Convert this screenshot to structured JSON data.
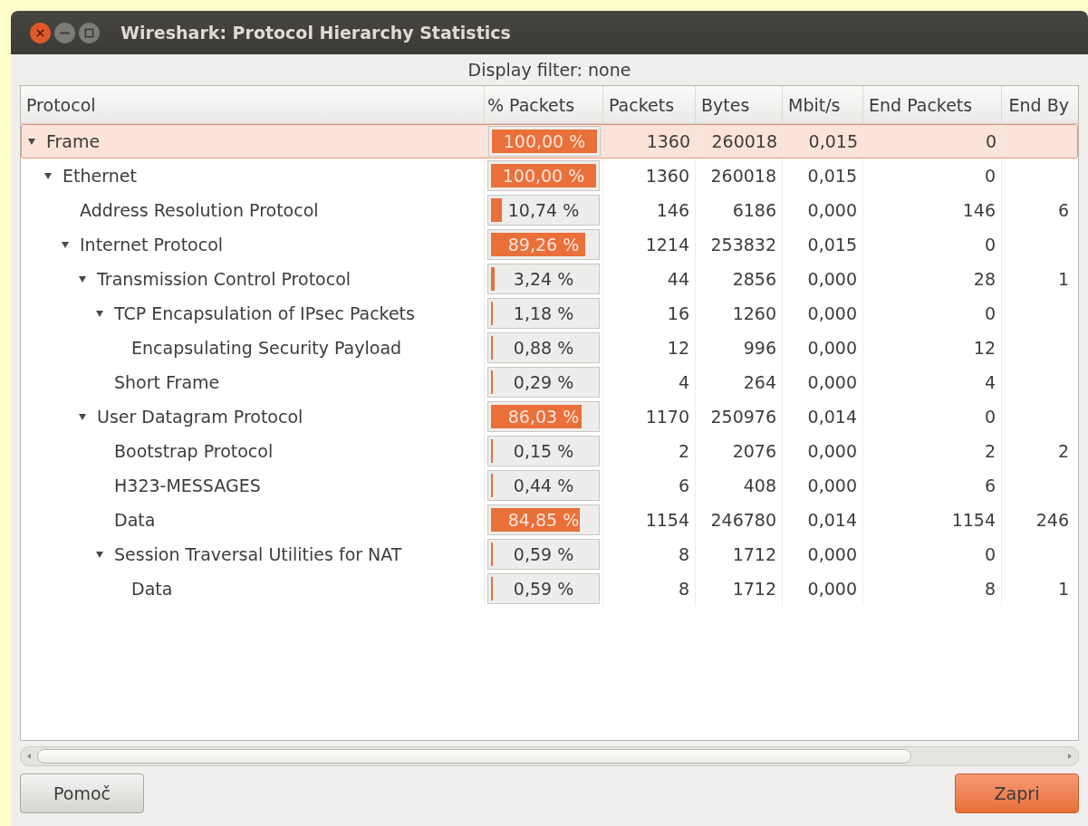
{
  "window": {
    "title": "Wireshark: Protocol Hierarchy Statistics"
  },
  "display_filter": "Display filter: none",
  "table": {
    "columns": [
      "Protocol",
      "% Packets",
      "Packets",
      "Bytes",
      "Mbit/s",
      "End Packets",
      "End By"
    ],
    "rows": [
      {
        "protocol": "Frame",
        "percent": "100,00 %",
        "level": 1.0,
        "packets": "1360",
        "bytes": "260018",
        "mbits": "0,015",
        "end_packets": "0",
        "selected": true,
        "expanded": true,
        "children": [
          {
            "protocol": "Ethernet",
            "percent": "100,00 %",
            "level": 1.0,
            "packets": "1360",
            "bytes": "260018",
            "mbits": "0,015",
            "end_packets": "0",
            "selected": false,
            "expanded": true,
            "children": [
              {
                "protocol": "Address Resolution Protocol",
                "percent": "10,74 %",
                "level": 0.1074,
                "packets": "146",
                "bytes": "6186",
                "mbits": "0,000",
                "end_packets": "146",
                "end_bytes": "6",
                "selected": false
              },
              {
                "protocol": "Internet Protocol",
                "percent": "89,26 %",
                "level": 0.8926,
                "packets": "1214",
                "bytes": "253832",
                "mbits": "0,015",
                "end_packets": "0",
                "selected": false,
                "expanded": true,
                "children": [
                  {
                    "protocol": "Transmission Control Protocol",
                    "percent": "3,24 %",
                    "level": 0.0324,
                    "packets": "44",
                    "bytes": "2856",
                    "mbits": "0,000",
                    "end_packets": "28",
                    "end_bytes": "1",
                    "selected": false,
                    "expanded": true,
                    "children": [
                      {
                        "protocol": "TCP Encapsulation of IPsec Packets",
                        "percent": "1,18 %",
                        "level": 0.0118,
                        "packets": "16",
                        "bytes": "1260",
                        "mbits": "0,000",
                        "end_packets": "0",
                        "selected": false,
                        "expanded": true,
                        "children": [
                          {
                            "protocol": "Encapsulating Security Payload",
                            "percent": "0,88 %",
                            "level": 0.0088,
                            "packets": "12",
                            "bytes": "996",
                            "mbits": "0,000",
                            "end_packets": "12",
                            "selected": false
                          }
                        ]
                      },
                      {
                        "protocol": "Short Frame",
                        "percent": "0,29 %",
                        "level": 0.0029,
                        "packets": "4",
                        "bytes": "264",
                        "mbits": "0,000",
                        "end_packets": "4",
                        "selected": false
                      }
                    ]
                  },
                  {
                    "protocol": "User Datagram Protocol",
                    "percent": "86,03 %",
                    "level": 0.8603,
                    "packets": "1170",
                    "bytes": "250976",
                    "mbits": "0,014",
                    "end_packets": "0",
                    "selected": false,
                    "expanded": true,
                    "children": [
                      {
                        "protocol": "Bootstrap Protocol",
                        "percent": "0,15 %",
                        "level": 0.0015,
                        "packets": "2",
                        "bytes": "2076",
                        "mbits": "0,000",
                        "end_packets": "2",
                        "end_bytes": "2",
                        "selected": false
                      },
                      {
                        "protocol": "H323-MESSAGES",
                        "percent": "0,44 %",
                        "level": 0.0044,
                        "packets": "6",
                        "bytes": "408",
                        "mbits": "0,000",
                        "end_packets": "6",
                        "selected": false
                      },
                      {
                        "protocol": "Data",
                        "percent": "84,85 %",
                        "level": 0.8485,
                        "packets": "1154",
                        "bytes": "246780",
                        "mbits": "0,014",
                        "end_packets": "1154",
                        "end_bytes": "246",
                        "selected": false
                      },
                      {
                        "protocol": "Session Traversal Utilities for NAT",
                        "percent": "0,59 %",
                        "level": 0.0059,
                        "packets": "8",
                        "bytes": "1712",
                        "mbits": "0,000",
                        "end_packets": "0",
                        "selected": false,
                        "expanded": true,
                        "children": [
                          {
                            "protocol": "Data",
                            "percent": "0,59 %",
                            "level": 0.0059,
                            "packets": "8",
                            "bytes": "1712",
                            "mbits": "0,000",
                            "end_packets": "8",
                            "end_bytes": "1",
                            "selected": false
                          }
                        ]
                      }
                    ]
                  }
                ]
              }
            ]
          }
        ]
      }
    ]
  },
  "buttons": [
    {
      "label": "Pomoč",
      "kind": "plain"
    },
    {
      "label": "Zapri",
      "kind": "primary"
    }
  ]
}
